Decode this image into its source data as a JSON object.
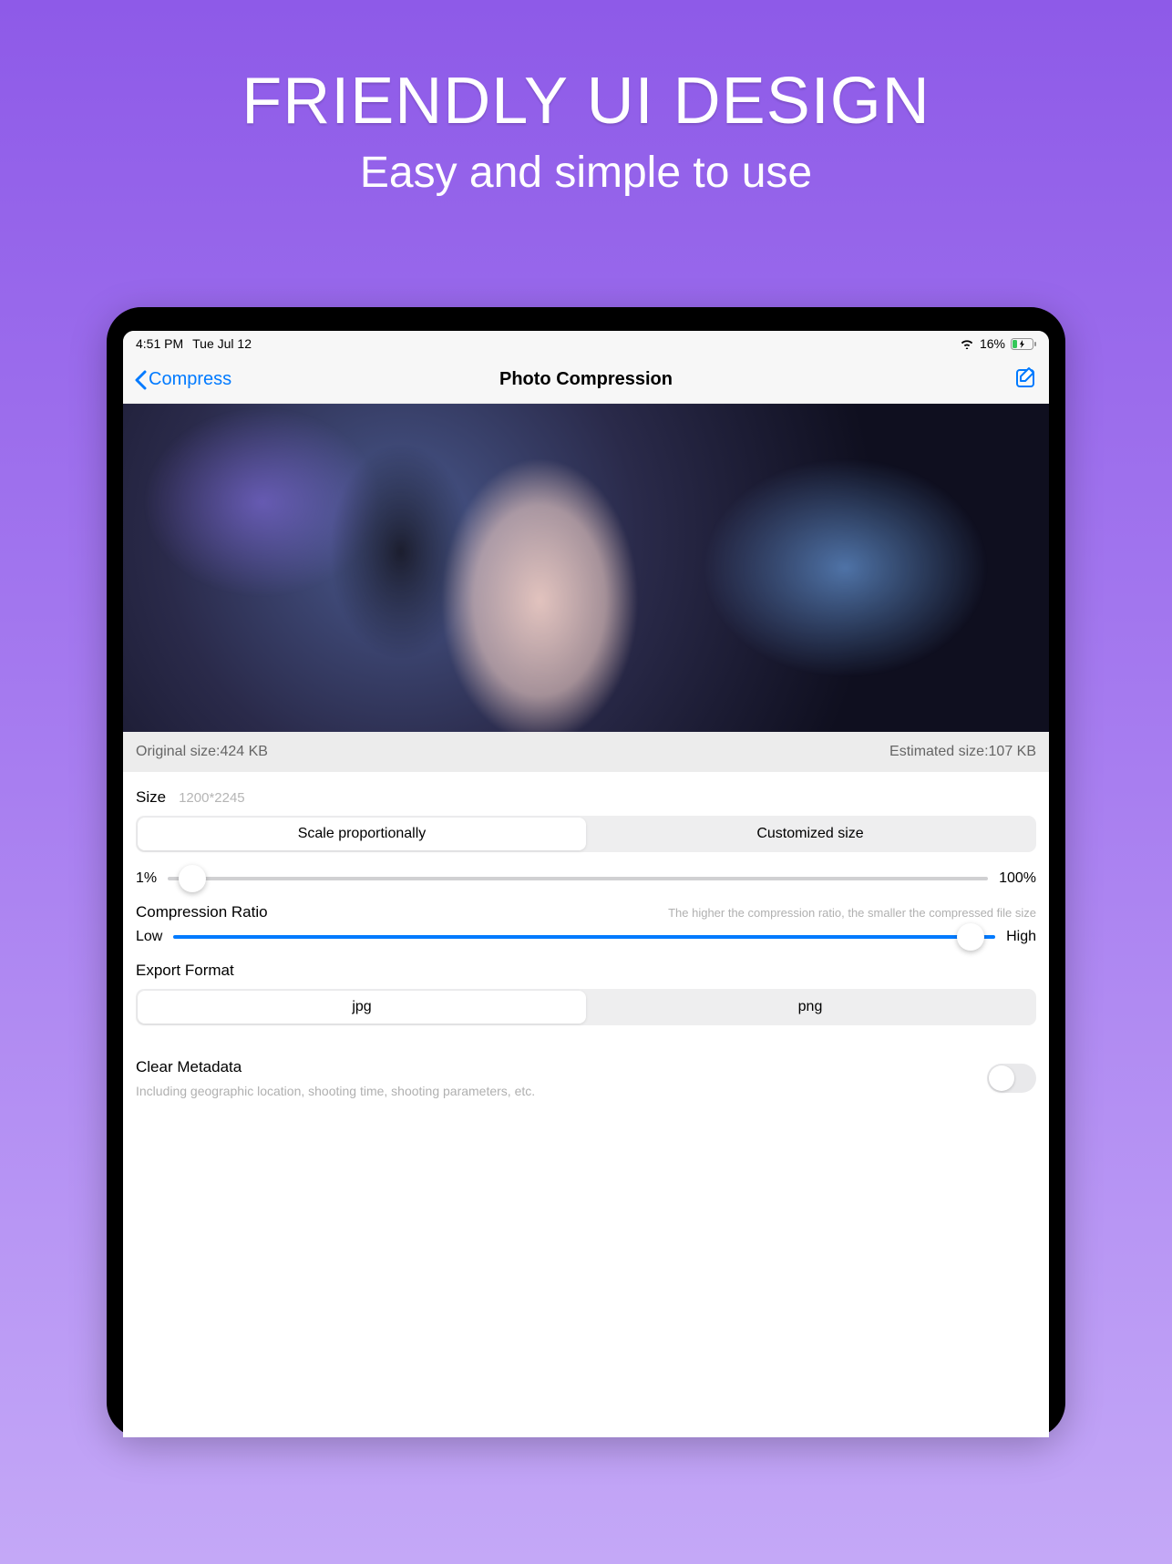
{
  "hero": {
    "title": "FRIENDLY UI DESIGN",
    "subtitle": "Easy and simple to use"
  },
  "status": {
    "time": "4:51 PM",
    "date": "Tue Jul 12",
    "battery_pct": "16%"
  },
  "nav": {
    "back_label": "Compress",
    "title": "Photo Compression"
  },
  "info": {
    "original_label": "Original size:424 KB",
    "estimated_label": "Estimated size:107 KB"
  },
  "size": {
    "label": "Size",
    "dimensions": "1200*2245",
    "seg_a": "Scale proportionally",
    "seg_b": "Customized size",
    "slider_min": "1%",
    "slider_max": "100%"
  },
  "ratio": {
    "label": "Compression Ratio",
    "hint": "The higher the compression ratio, the smaller the compressed file size",
    "low": "Low",
    "high": "High"
  },
  "format": {
    "label": "Export Format",
    "seg_a": "jpg",
    "seg_b": "png"
  },
  "metadata": {
    "label": "Clear Metadata",
    "sub": "Including geographic location, shooting time, shooting parameters, etc."
  }
}
